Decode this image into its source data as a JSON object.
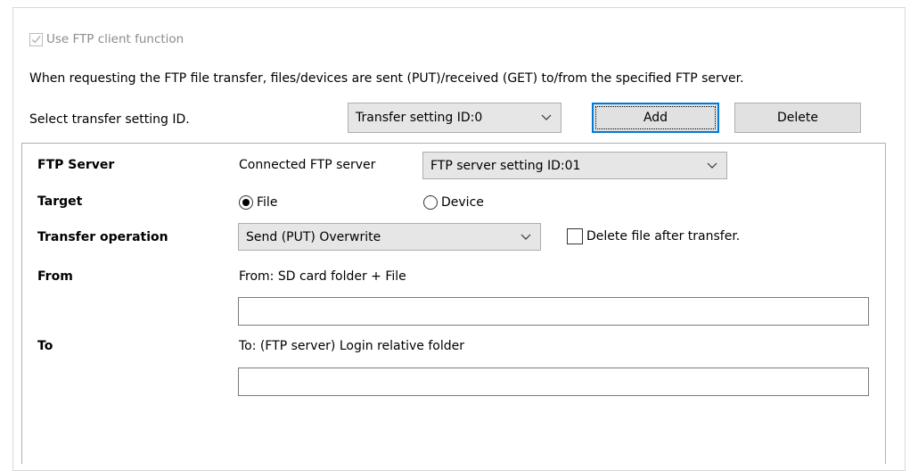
{
  "use_ftp_client": {
    "label": "Use FTP client function",
    "checked": true,
    "enabled": false
  },
  "description": "When requesting the FTP file transfer, files/devices are sent (PUT)/received (GET) to/from the specified FTP server.",
  "transfer_select": {
    "label": "Select transfer setting ID.",
    "value": "Transfer setting ID:0",
    "add_label": "Add",
    "delete_label": "Delete"
  },
  "ftp_server": {
    "label": "FTP Server",
    "sublabel": "Connected FTP server",
    "value": "FTP server setting ID:01"
  },
  "target": {
    "label": "Target",
    "options": [
      "File",
      "Device"
    ],
    "selected": "File"
  },
  "transfer_operation": {
    "label": "Transfer operation",
    "value": "Send (PUT) Overwrite",
    "delete_after_label": "Delete file after transfer.",
    "delete_after_checked": false
  },
  "from": {
    "label": "From",
    "sublabel": "From: SD card folder + File",
    "value": ""
  },
  "to": {
    "label": "To",
    "sublabel": "To: (FTP server) Login relative folder",
    "value": ""
  },
  "icons": {
    "dropdown": "chevron-down-icon",
    "check": "check-icon"
  },
  "colors": {
    "button_bg": "#e1e1e1",
    "dropdown_bg": "#e6e6e6",
    "accent": "#0078d7",
    "disabled_text": "#8c8c8c"
  }
}
